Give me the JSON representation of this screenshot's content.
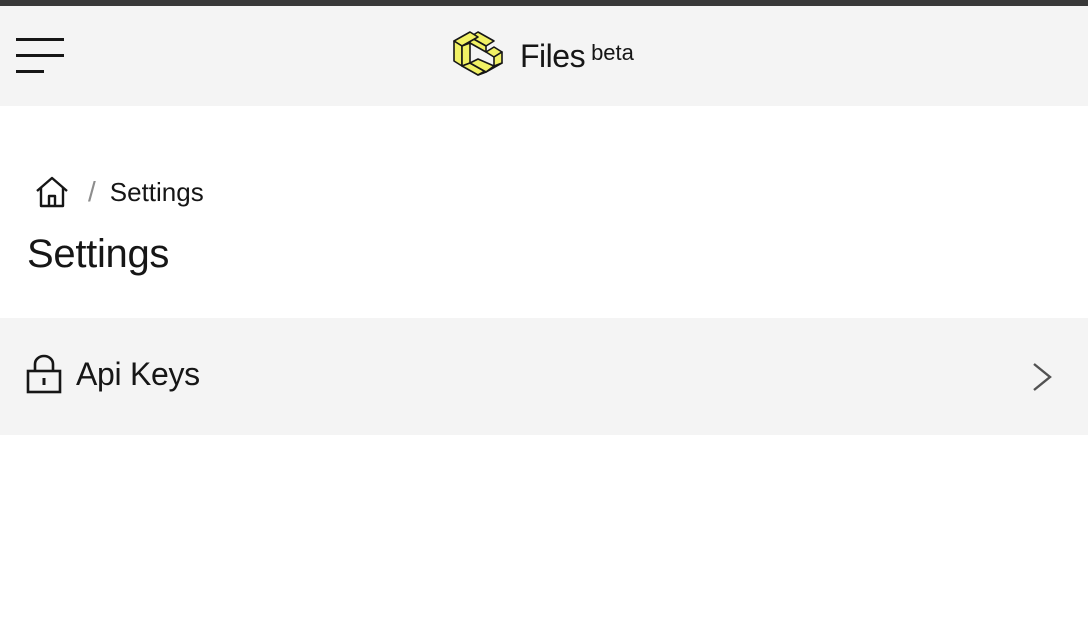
{
  "header": {
    "menu_icon": "hamburger-menu-icon",
    "brand_logo_icon": "carbon-cube-logo",
    "brand_name": "Files",
    "brand_tag": "beta",
    "colors": {
      "background": "#f4f4f4",
      "top_strip": "#393939",
      "logo_fill": "#f1f165"
    }
  },
  "breadcrumb": {
    "home_icon": "home-icon",
    "separator": "/",
    "current": "Settings"
  },
  "page": {
    "title": "Settings"
  },
  "settings": {
    "items": [
      {
        "label": "Api Keys",
        "icon": "lock-icon",
        "action_icon": "chevron-right-icon"
      }
    ]
  }
}
